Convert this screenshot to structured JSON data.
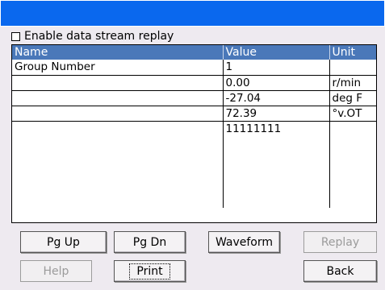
{
  "replay": {
    "label": "Enable data stream replay",
    "checked": false
  },
  "table": {
    "headers": {
      "name": "Name",
      "value": "Value",
      "unit": "Unit"
    },
    "rows": [
      {
        "name": "Group Number",
        "value": "1",
        "unit": ""
      },
      {
        "name": "",
        "value": "0.00",
        "unit": "r/min"
      },
      {
        "name": "",
        "value": "-27.04",
        "unit": "deg F"
      },
      {
        "name": "",
        "value": "72.39",
        "unit": "°v.OT"
      },
      {
        "name": "",
        "value": "11111111",
        "unit": ""
      }
    ]
  },
  "buttons": {
    "pg_up": "Pg Up",
    "pg_dn": "Pg Dn",
    "waveform": "Waveform",
    "replay": "Replay",
    "help": "Help",
    "print": "Print",
    "back": "Back"
  }
}
